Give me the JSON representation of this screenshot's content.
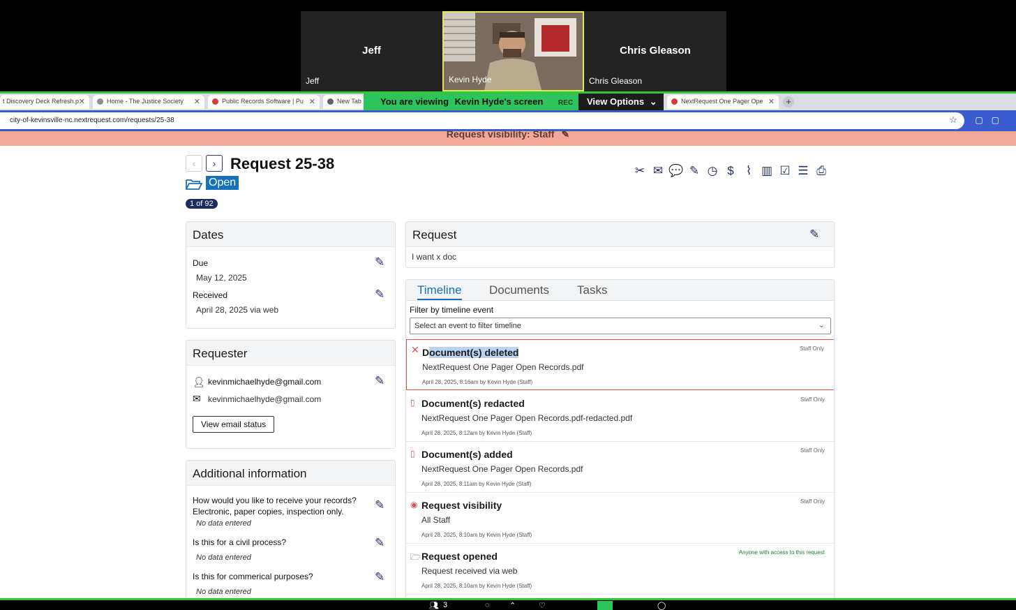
{
  "zoom": {
    "participants": [
      {
        "big_name": "Jeff",
        "label": "Jeff"
      },
      {
        "big_name": "",
        "label": "Kevin Hyde"
      },
      {
        "big_name": "Chris Gleason",
        "label": "Chris Gleason"
      }
    ],
    "viewing_text": "You are viewing",
    "viewing_name": "Kevin Hyde's screen",
    "rec": "REC",
    "view_options": "View Options",
    "bottom_count": "3"
  },
  "browser": {
    "tabs": [
      {
        "title": "t Discovery Deck Refresh.p"
      },
      {
        "title": "Home - The Justice Society"
      },
      {
        "title": "Public Records Software | Pu"
      },
      {
        "title": "New Tab"
      },
      {
        "title": "NextRequest One Pager Ope"
      }
    ],
    "url": "city-of-kevinsville-nc.nextrequest.com/requests/25-38"
  },
  "page": {
    "visibility_text": "Request visibility:  Staff",
    "title": "Request 25-38",
    "status": "Open",
    "counter": "1 of 92",
    "dates": {
      "heading": "Dates",
      "due_label": "Due",
      "due_value": "May 12, 2025",
      "received_label": "Received",
      "received_value": "April 28, 2025 via web"
    },
    "requester": {
      "heading": "Requester",
      "name": "kevinmichaelhyde@gmail.com",
      "email": "kevinmichaelhyde@gmail.com",
      "email_status_button": "View email status"
    },
    "additional": {
      "heading": "Additional information",
      "questions": [
        {
          "q": "How would you like to receive your records? Electronic, paper copies, inspection only.",
          "a": "No data entered"
        },
        {
          "q": "Is this for a civil process?",
          "a": "No data entered"
        },
        {
          "q": "Is this for commerical purposes?",
          "a": "No data entered"
        }
      ]
    },
    "request": {
      "heading": "Request",
      "body": "I want x doc"
    },
    "timeline": {
      "tabs": [
        "Timeline",
        "Documents",
        "Tasks"
      ],
      "filter_label": "Filter by timeline event",
      "filter_placeholder": "Select an event to filter timeline",
      "events": [
        {
          "title": "Document(s) deleted",
          "detail": "NextRequest One Pager Open Records.pdf",
          "meta": "April 28, 2025, 8:16am by Kevin Hyde (Staff)",
          "scope": "Staff Only"
        },
        {
          "title": "Document(s) redacted",
          "detail": "NextRequest One Pager Open Records.pdf-redacted.pdf",
          "meta": "April 28, 2025, 8:12am by Kevin Hyde (Staff)",
          "scope": "Staff Only"
        },
        {
          "title": "Document(s) added",
          "detail": "NextRequest One Pager Open Records.pdf",
          "meta": "April 28, 2025, 8:11am by Kevin Hyde (Staff)",
          "scope": "Staff Only"
        },
        {
          "title": "Request visibility",
          "detail": "All Staff",
          "meta": "April 28, 2025, 8:10am by Kevin Hyde (Staff)",
          "scope": "Staff Only"
        },
        {
          "title": "Request opened",
          "detail": "Request received via web",
          "meta": "April 28, 2025, 8:10am by Kevin Hyde (Staff)",
          "scope": "Anyone with access to this request"
        }
      ]
    }
  },
  "colors": {
    "accent": "#1570b8",
    "navy": "#1d2d5f",
    "visibility_bar": "#f4a898",
    "zoom_green": "#2ec45c",
    "delete_red": "#d9534f"
  }
}
